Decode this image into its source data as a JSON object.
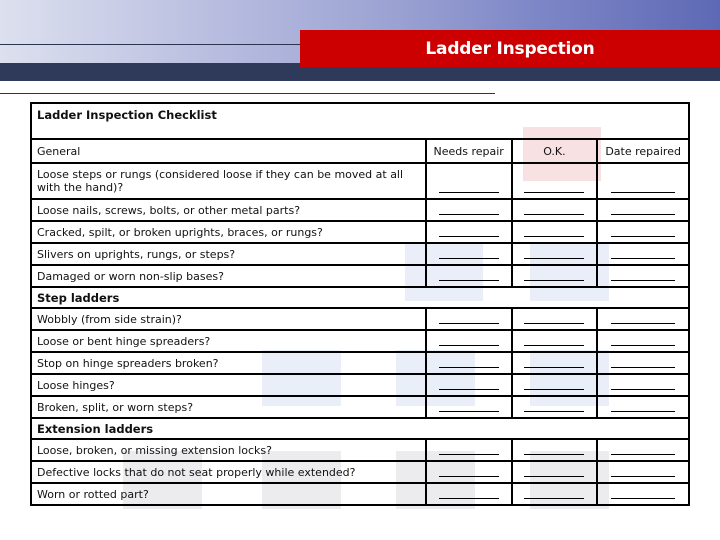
{
  "header": {
    "title": "Ladder Inspection"
  },
  "checklist": {
    "title": "Ladder Inspection Checklist",
    "columns": {
      "category": "General",
      "needs_repair": "Needs repair",
      "ok": "O.K.",
      "date_repaired": "Date repaired"
    },
    "blank": "",
    "sections": [
      {
        "name": "General",
        "items": [
          "Loose steps or rungs (considered loose if they can be moved at all with the hand)?",
          "Loose nails, screws, bolts, or other metal parts?",
          "Cracked, spilt, or broken uprights, braces, or rungs?",
          "Slivers on uprights, rungs, or steps?",
          "Damaged or worn non-slip bases?"
        ]
      },
      {
        "name": "Step ladders",
        "items": [
          "Wobbly (from side strain)?",
          "Loose or bent hinge spreaders?",
          "Stop on hinge spreaders broken?",
          "Loose hinges?",
          "Broken, split, or worn steps?"
        ]
      },
      {
        "name": "Extension ladders",
        "items": [
          "Loose, broken, or missing extension locks?",
          "Defective locks that do not seat properly while extended?",
          "Worn or rotted part?"
        ]
      }
    ]
  },
  "colors": {
    "banner_red": "#cc0000",
    "navy": "#2f3a5a",
    "gradient_start": "#dde0ee",
    "gradient_end": "#5e69b5"
  }
}
